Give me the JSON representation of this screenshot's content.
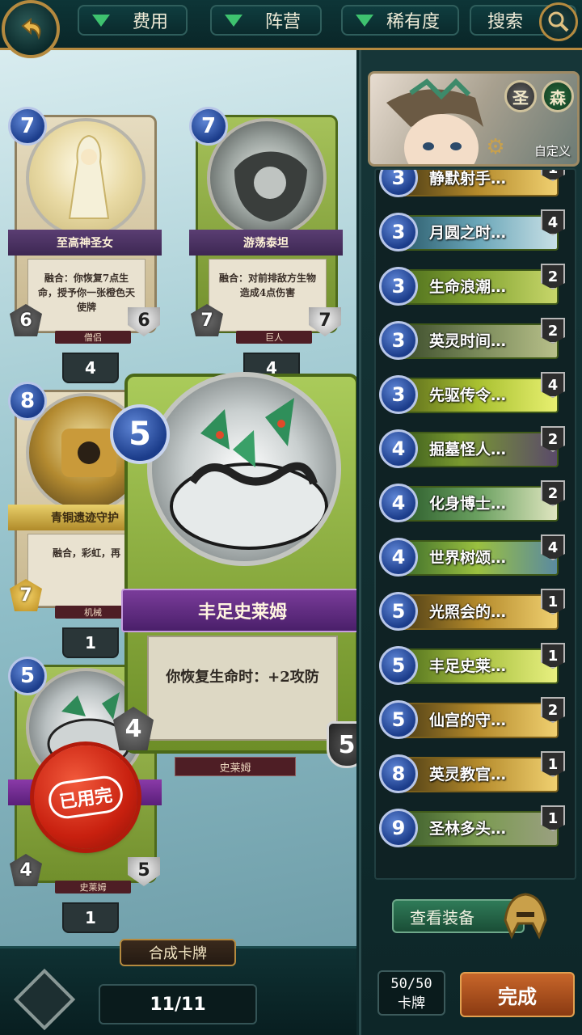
{
  "filters": {
    "cost": "费用",
    "faction": "阵营",
    "rarity": "稀有度",
    "search": "搜索"
  },
  "cards": [
    {
      "cost": "7",
      "name": "至高神圣女",
      "text": "融合：你恢复7点生命，授予你一张橙色天使牌",
      "type": "僧侣",
      "atk": "6",
      "hp": "6",
      "count": "4"
    },
    {
      "cost": "7",
      "name": "游荡泰坦",
      "text": "融合：对前排敌方生物造成4点伤害",
      "type": "巨人",
      "atk": "7",
      "hp": "7",
      "count": "4"
    },
    {
      "cost": "8",
      "name": "青铜遗迹守护",
      "text": "融合，彩虹，再",
      "type": "机械",
      "atk": "7",
      "hp": "",
      "count": "1"
    },
    {
      "cost": "5",
      "name": "丰足史莱姆",
      "text": "",
      "type": "史莱姆",
      "atk": "4",
      "hp": "5",
      "count": "1"
    }
  ],
  "preview": {
    "cost": "5",
    "name": "丰足史莱姆",
    "text": "你恢复生命时：+2攻防",
    "type": "史莱姆",
    "atk": "4",
    "hp": "5"
  },
  "stamp": "已用完",
  "craft_label": "合成卡牌",
  "page": "11/11",
  "hero": {
    "faction1": "圣",
    "faction2": "森",
    "label": "自定义"
  },
  "deck": [
    {
      "cost": "3",
      "name": "静默射手…",
      "qty": "1"
    },
    {
      "cost": "3",
      "name": "月圆之时…",
      "qty": "4"
    },
    {
      "cost": "3",
      "name": "生命浪潮…",
      "qty": "2"
    },
    {
      "cost": "3",
      "name": "英灵时间…",
      "qty": "2"
    },
    {
      "cost": "3",
      "name": "先驱传令…",
      "qty": "4"
    },
    {
      "cost": "4",
      "name": "掘墓怪人…",
      "qty": "2"
    },
    {
      "cost": "4",
      "name": "化身博士…",
      "qty": "2"
    },
    {
      "cost": "4",
      "name": "世界树颂…",
      "qty": "4"
    },
    {
      "cost": "5",
      "name": "光照会的…",
      "qty": "1"
    },
    {
      "cost": "5",
      "name": "丰足史莱…",
      "qty": "1"
    },
    {
      "cost": "5",
      "name": "仙宫的守…",
      "qty": "2"
    },
    {
      "cost": "8",
      "name": "英灵教官…",
      "qty": "1"
    },
    {
      "cost": "9",
      "name": "圣林多头…",
      "qty": "1"
    }
  ],
  "equip_button": "查看装备",
  "deck_count": {
    "value": "50/50",
    "label": "卡牌"
  },
  "done_button": "完成",
  "colors": {
    "accent_gold": "#b58a3f",
    "mana_blue": "#1b3c8a",
    "done_orange": "#c8662a",
    "equip_green": "#2f7b58"
  }
}
